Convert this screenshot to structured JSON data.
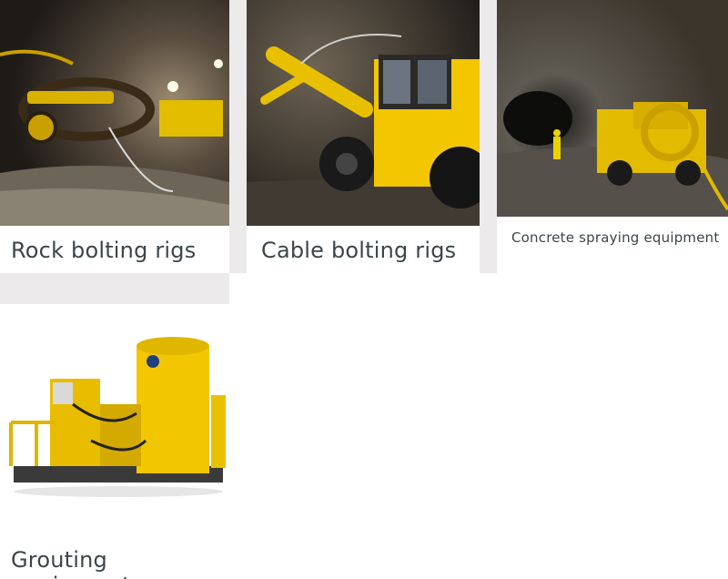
{
  "cards": [
    {
      "label": "Rock bolting rigs"
    },
    {
      "label": "Cable bolting rigs"
    },
    {
      "label": "Concrete spraying equipment"
    },
    {
      "label": "Grouting equipment"
    }
  ],
  "colors": {
    "background": "#ffffff",
    "gutter": "#eceaea",
    "text": "#3d4549",
    "machine_yellow": "#f2c600"
  }
}
